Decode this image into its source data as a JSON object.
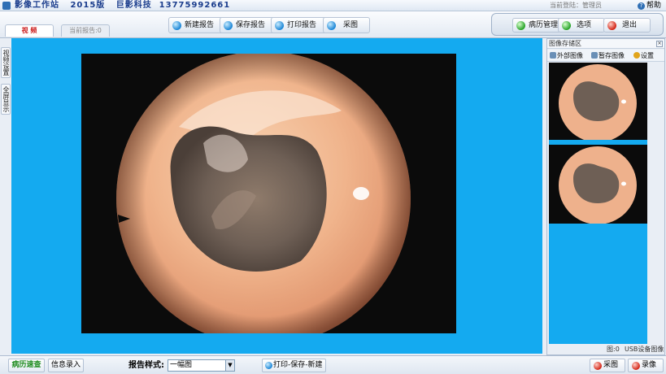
{
  "title_bar": {
    "app_title": "影像工作站   2015版   巨影科技  13775992661",
    "login_info": "当前登陆：管理员",
    "help_label": "帮助"
  },
  "tabs": [
    {
      "label": "视 频",
      "active": true
    },
    {
      "label": "当前报告:0",
      "active": false
    }
  ],
  "toolbar": {
    "new_report": "新建报告",
    "save_report": "保存报告",
    "print_report": "打印报告",
    "capture": "采图",
    "records": "病历管理",
    "options": "选项",
    "exit": "退出"
  },
  "left_tabs": {
    "video_settings": "视频设置",
    "fullscreen": "全屏显示"
  },
  "image_store": {
    "title": "图像存储区",
    "close_label": "×",
    "external_image": "外部图像",
    "temp_image": "暂存图像",
    "settings": "设置",
    "count_label": "图:0",
    "usb_label": "USB设备图像"
  },
  "status_bar": {
    "quick_records": "病历速查",
    "info_entry": "信息录入",
    "report_style_label": "报告样式:",
    "report_style_value": "一幅图",
    "print_save_new": "打印-保存-新建",
    "capture": "采图",
    "record": "录像"
  },
  "colors": {
    "video_background": "#14aaf0",
    "title_text": "#1a3c8c",
    "active_tab_text": "#cc2020"
  }
}
